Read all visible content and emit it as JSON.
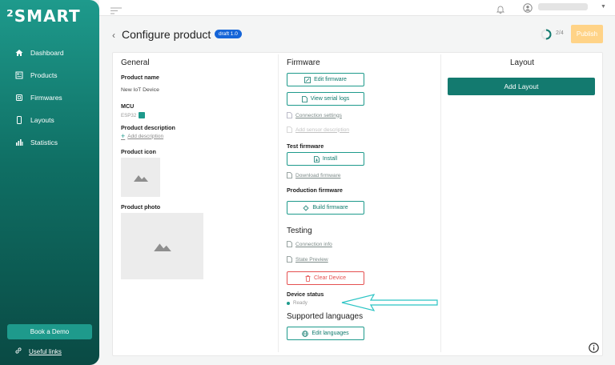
{
  "app": {
    "logo": "²SMART"
  },
  "sidebar": {
    "items": [
      {
        "label": "Dashboard",
        "icon": "home-icon"
      },
      {
        "label": "Products",
        "icon": "products-icon"
      },
      {
        "label": "Firmwares",
        "icon": "firmware-icon"
      },
      {
        "label": "Layouts",
        "icon": "layouts-icon"
      },
      {
        "label": "Statistics",
        "icon": "statistics-icon"
      }
    ],
    "book_demo": "Book a Demo",
    "useful_links": "Useful links"
  },
  "header": {
    "title": "Configure product",
    "badge": "draft 1.0",
    "progress_text": "2/4",
    "progress": 0.5,
    "publish": "Publish"
  },
  "general": {
    "heading": "General",
    "product_name_label": "Product name",
    "product_name_value": "New IoT Device",
    "mcu_label": "MCU",
    "mcu_value": "ESP32",
    "description_label": "Product description",
    "add_description": "Add description",
    "icon_label": "Product icon",
    "photo_label": "Product photo"
  },
  "firmware": {
    "heading": "Firmware",
    "edit_firmware": "Edit firmware",
    "view_serial_logs": "View serial logs",
    "connection_settings": "Connection settings",
    "add_sensor_description": "Add sensor description",
    "test_firmware_label": "Test firmware",
    "install": "Install",
    "download_firmware": "Download firmware",
    "production_firmware_label": "Production firmware",
    "build_firmware": "Build firmware"
  },
  "testing": {
    "heading": "Testing",
    "connection_info": "Connection info",
    "state_preview": "State Preview",
    "clear_device": "Clear Device",
    "device_status_label": "Device status",
    "device_status_value": "Ready"
  },
  "languages": {
    "heading": "Supported languages",
    "edit_languages": "Edit languages"
  },
  "layout": {
    "heading": "Layout",
    "add_layout": "Add Layout"
  },
  "colors": {
    "accent": "#1e9a8c",
    "publish": "#ffd387",
    "badge": "#1565d8",
    "danger": "#e55151"
  }
}
